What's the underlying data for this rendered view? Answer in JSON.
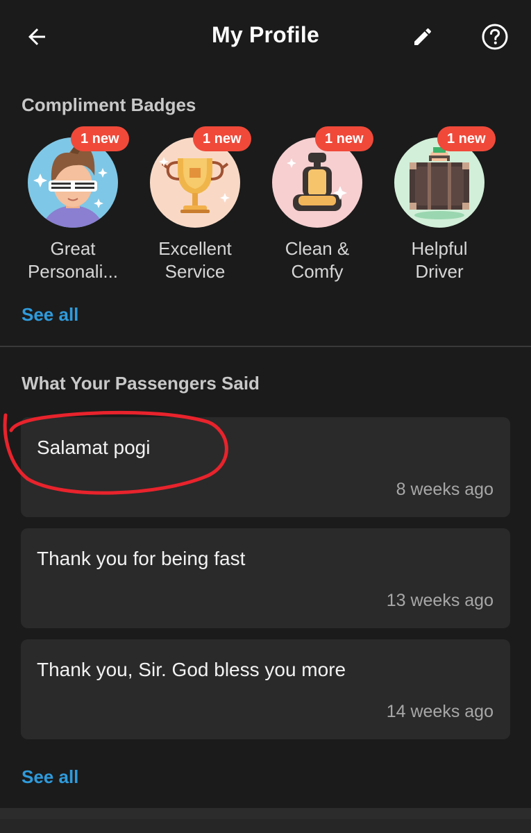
{
  "header": {
    "title": "My Profile",
    "back_icon": "arrow-left-icon",
    "edit_icon": "pencil-icon",
    "help_icon": "question-circle-icon"
  },
  "badges": {
    "title": "Compliment Badges",
    "see_all": "See all",
    "items": [
      {
        "line1": "Great",
        "line2": "Personali...",
        "new_label": "1 new",
        "icon": "great-personality-badge-icon"
      },
      {
        "line1": "Excellent",
        "line2": "Service",
        "new_label": "1 new",
        "icon": "trophy-badge-icon"
      },
      {
        "line1": "Clean &",
        "line2": "Comfy",
        "new_label": "1 new",
        "icon": "car-seat-badge-icon"
      },
      {
        "line1": "Helpful",
        "line2": "Driver",
        "new_label": "1 new",
        "icon": "suitcase-badge-icon"
      }
    ]
  },
  "comments": {
    "title": "What Your Passengers Said",
    "see_all": "See all",
    "items": [
      {
        "text": "Salamat pogi",
        "time": "8 weeks ago"
      },
      {
        "text": "Thank you for being fast",
        "time": "13 weeks ago"
      },
      {
        "text": "Thank you, Sir. God bless you more",
        "time": "14 weeks ago"
      }
    ]
  },
  "colors": {
    "background": "#1b1b1b",
    "card": "#2a2a2a",
    "accent_link": "#2f9bdc",
    "new_badge": "#f0493a",
    "annotation": "#e8232c"
  }
}
